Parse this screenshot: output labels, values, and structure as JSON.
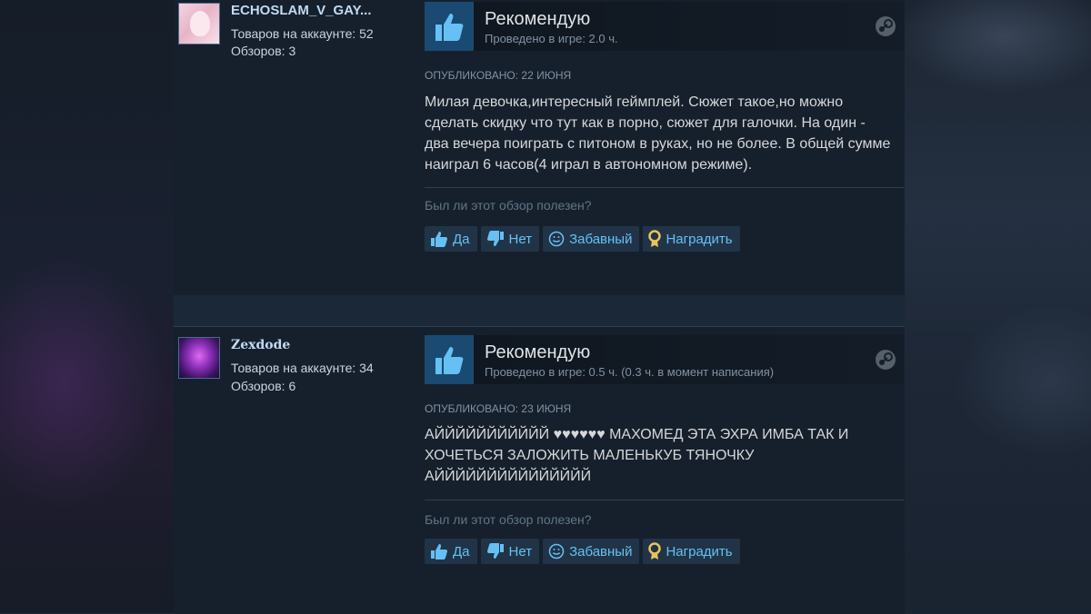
{
  "reviews": [
    {
      "username": "ECHOSLAM_V_GAY...",
      "products": "Товаров на аккаунте: 52",
      "reviews_count": "Обзоров: 3",
      "verdict": "Рекомендую",
      "hours": "Проведено в игре: 2.0 ч.",
      "posted": "ОПУБЛИКОВАНО: 22 ИЮНЯ",
      "text": "Милая девочка,интересный геймплей. Сюжет такое,но можно сделать скидку что тут как в порно, сюжет для галочки. На один - два вечера поиграть с питоном в руках, но не более. В общей сумме наиграл 6 часов(4 играл в автономном режиме)."
    },
    {
      "username": "Zexdode",
      "products": "Товаров на аккаунте: 34",
      "reviews_count": "Обзоров: 6",
      "verdict": "Рекомендую",
      "hours": "Проведено в игре: 0.5 ч. (0.3 ч. в момент написания)",
      "posted": "ОПУБЛИКОВАНО: 23 ИЮНЯ",
      "text": "АЙЙЙЙЙЙЙЙЙЙЙ ♥♥♥♥♥♥ МАХОМЕД ЭТА ЭХРА ИМБА ТАК И ХОЧЕТЬСЯ ЗАЛОЖИТЬ МАЛЕНЬКУБ ТЯНОЧКУ АЙЙЙЙЙЙЙЙЙЙЙЙЙЙЙ"
    }
  ],
  "helpful": {
    "question": "Был ли этот обзор полезен?",
    "yes": "Да",
    "no": "Нет",
    "funny": "Забавный",
    "award": "Наградить"
  },
  "colors": {
    "page_bg": "#1b2838",
    "panel_bg": "#16202d",
    "button_bg": "#213447",
    "link_blue": "#66c0f4",
    "thumb_box": "#1a4a72"
  },
  "icons": [
    "thumbs-up-icon",
    "thumbs-down-icon",
    "smiley-icon",
    "award-icon",
    "steam-icon"
  ]
}
